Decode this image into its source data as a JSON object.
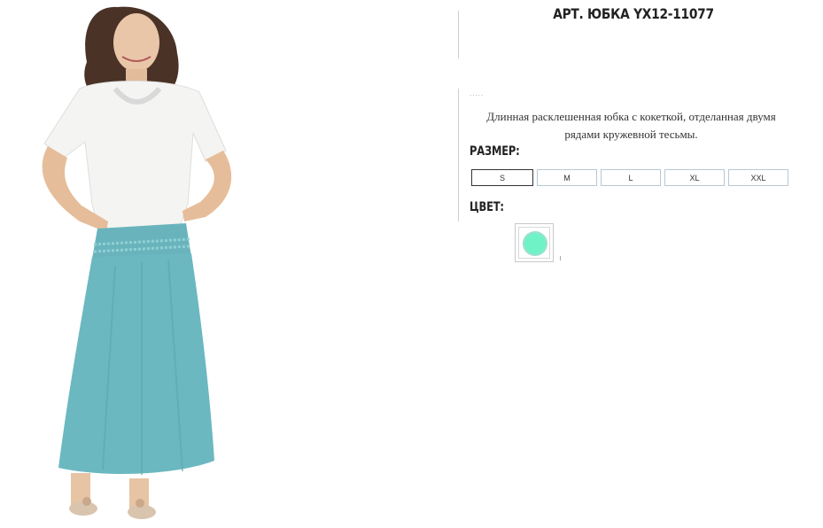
{
  "product": {
    "title": "АРТ. ЮБКА YX12-11077",
    "dots": ".....",
    "description": "Длинная расклешенная юбка с кокеткой, отделанная двумя рядами кружевной тесьмы."
  },
  "size_section": {
    "label": "РАЗМЕР:",
    "options": [
      "S",
      "M",
      "L",
      "XL",
      "XXL"
    ],
    "selected": "S"
  },
  "color_section": {
    "label": "ЦВЕТ:",
    "swatch_color": "#6ff2c6"
  },
  "photo": {
    "skirt_color": "#6bb8c0",
    "top_color": "#f4f4f2",
    "hair_color": "#4a3226"
  }
}
